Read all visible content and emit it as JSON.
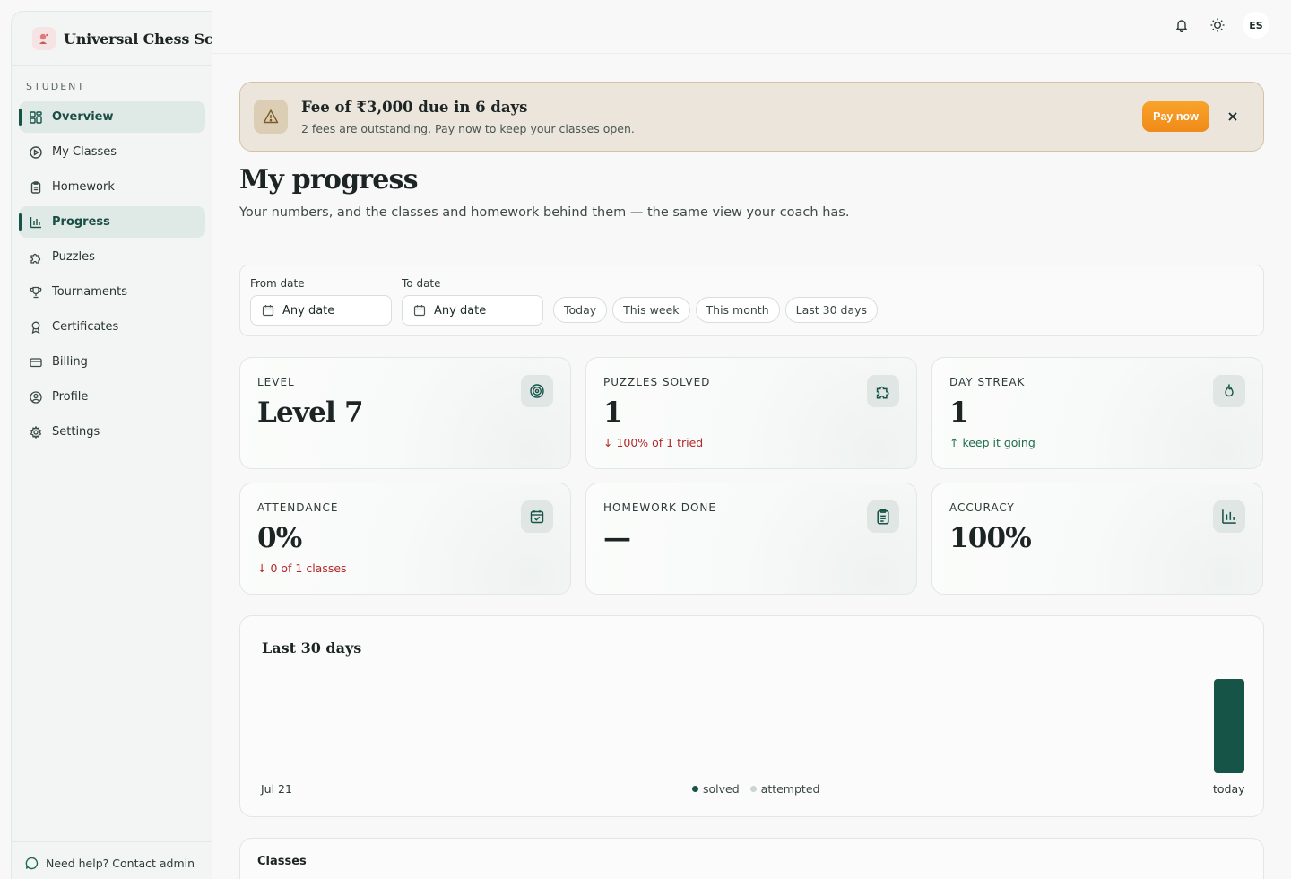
{
  "brand": {
    "name": "Universal Chess Sch"
  },
  "sidebar": {
    "section": "STUDENT",
    "items": [
      {
        "label": "Overview",
        "icon": "grid-icon",
        "active": true
      },
      {
        "label": "My Classes",
        "icon": "play-circle-icon",
        "active": false
      },
      {
        "label": "Homework",
        "icon": "clipboard-icon",
        "active": false
      },
      {
        "label": "Progress",
        "icon": "bar-chart-icon",
        "active": true
      },
      {
        "label": "Puzzles",
        "icon": "puzzle-icon",
        "active": false
      },
      {
        "label": "Tournaments",
        "icon": "trophy-icon",
        "active": false
      },
      {
        "label": "Certificates",
        "icon": "award-icon",
        "active": false
      },
      {
        "label": "Billing",
        "icon": "credit-card-icon",
        "active": false
      },
      {
        "label": "Profile",
        "icon": "user-circle-icon",
        "active": false
      },
      {
        "label": "Settings",
        "icon": "gear-icon",
        "active": false
      }
    ],
    "help": "Need help? Contact admin"
  },
  "topbar": {
    "avatar_initials": "ES"
  },
  "banner": {
    "title": "Fee of ₹3,000 due in 6 days",
    "subtitle": "2 fees are outstanding. Pay now to keep your classes open.",
    "pay_label": "Pay now"
  },
  "page": {
    "title": "My progress",
    "subtitle": "Your numbers, and the classes and homework behind them — the same view your coach has."
  },
  "filters": {
    "from_label": "From date",
    "from_value": "Any date",
    "to_label": "To date",
    "to_value": "Any date",
    "presets": [
      "Today",
      "This week",
      "This month",
      "Last 30 days"
    ]
  },
  "stats": [
    {
      "label": "LEVEL",
      "value": "Level 7",
      "trend": "",
      "trend_dir": "",
      "icon": "target-icon"
    },
    {
      "label": "PUZZLES SOLVED",
      "value": "1",
      "trend": "↓ 100% of 1 tried",
      "trend_dir": "down",
      "icon": "puzzle-icon"
    },
    {
      "label": "DAY STREAK",
      "value": "1",
      "trend": "↑ keep it going",
      "trend_dir": "up",
      "icon": "flame-icon"
    },
    {
      "label": "ATTENDANCE",
      "value": "0%",
      "trend": "↓ 0 of 1 classes",
      "trend_dir": "down",
      "icon": "calendar-check-icon"
    },
    {
      "label": "HOMEWORK DONE",
      "value": "—",
      "trend": "",
      "trend_dir": "",
      "icon": "clipboard-icon"
    },
    {
      "label": "ACCURACY",
      "value": "100%",
      "trend": "",
      "trend_dir": "",
      "icon": "bar-chart-icon"
    }
  ],
  "colors": {
    "accent": "#175448",
    "cta": "#f59a22",
    "down": "#b02a2a",
    "up": "#1d6b4a",
    "attempted": "#c9d6d2"
  },
  "chart_data": {
    "type": "bar",
    "title": "Last 30 days",
    "x_start_label": "Jul 21",
    "x_end_label": "today",
    "days": 30,
    "series": [
      {
        "name": "solved",
        "values": [
          0,
          0,
          0,
          0,
          0,
          0,
          0,
          0,
          0,
          0,
          0,
          0,
          0,
          0,
          0,
          0,
          0,
          0,
          0,
          0,
          0,
          0,
          0,
          0,
          0,
          0,
          0,
          0,
          0,
          1
        ]
      },
      {
        "name": "attempted",
        "values": [
          0,
          0,
          0,
          0,
          0,
          0,
          0,
          0,
          0,
          0,
          0,
          0,
          0,
          0,
          0,
          0,
          0,
          0,
          0,
          0,
          0,
          0,
          0,
          0,
          0,
          0,
          0,
          0,
          0,
          0
        ]
      }
    ],
    "ylim": [
      0,
      1
    ],
    "grid": false,
    "legend": "bottom-center"
  },
  "classes": {
    "title": "Classes"
  }
}
